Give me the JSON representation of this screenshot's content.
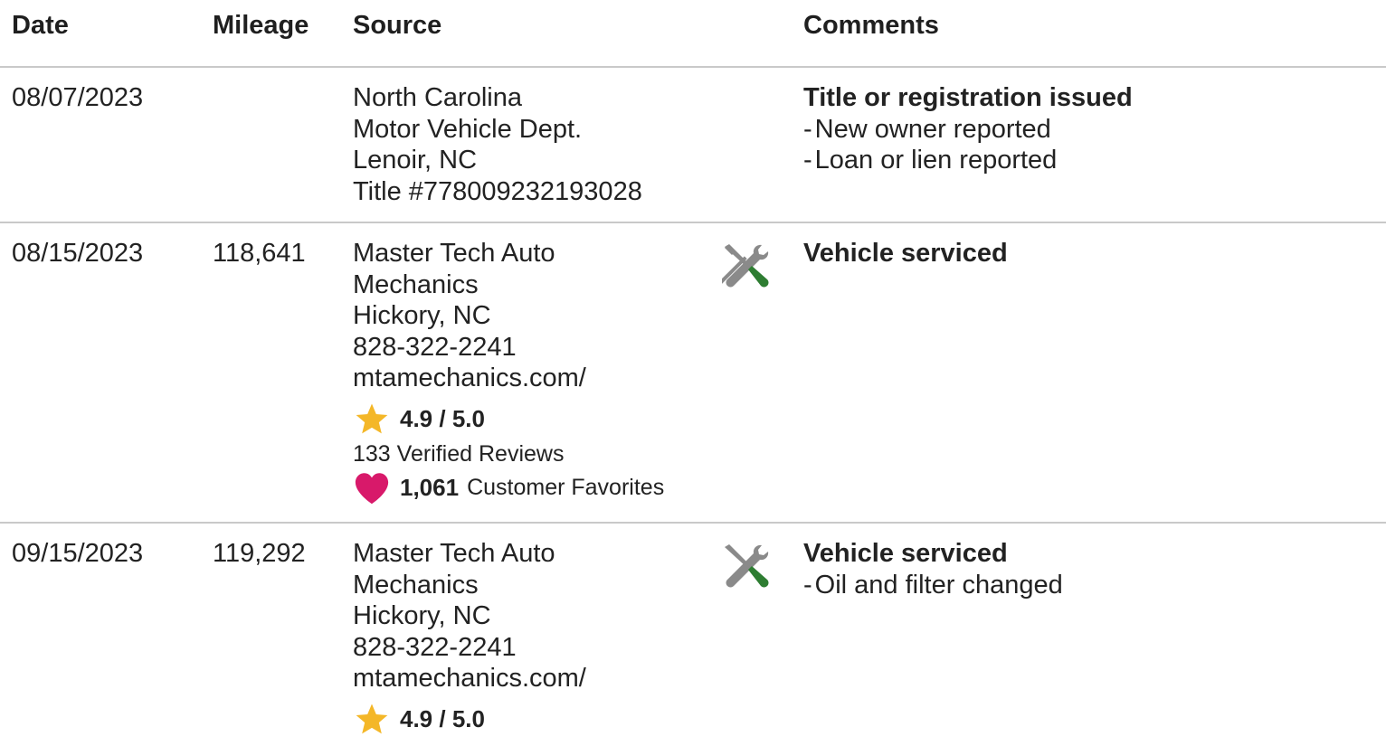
{
  "header": {
    "date": "Date",
    "mileage": "Mileage",
    "source": "Source",
    "comments": "Comments"
  },
  "rows": [
    {
      "date": "08/07/2023",
      "mileage": "",
      "source": {
        "lines": [
          "North Carolina",
          "Motor Vehicle Dept.",
          "Lenoir, NC",
          "Title #778009232193028"
        ]
      },
      "icon": "",
      "comment": {
        "title": "Title or registration issued",
        "items": [
          "New owner reported",
          "Loan or lien reported"
        ]
      }
    },
    {
      "date": "08/15/2023",
      "mileage": "118,641",
      "source": {
        "lines": [
          "Master Tech Auto",
          "Mechanics",
          "Hickory, NC",
          "828-322-2241",
          "mtamechanics.com/"
        ],
        "rating": "4.9 / 5.0",
        "reviews": "133 Verified Reviews",
        "favorites_count": "1,061",
        "favorites_label": "Customer Favorites"
      },
      "icon": "service-tools-icon",
      "comment": {
        "title": "Vehicle serviced",
        "items": []
      }
    },
    {
      "date": "09/15/2023",
      "mileage": "119,292",
      "source": {
        "lines": [
          "Master Tech Auto",
          "Mechanics",
          "Hickory, NC",
          "828-322-2241",
          "mtamechanics.com/"
        ],
        "rating": "4.9 / 5.0"
      },
      "icon": "service-tools-icon",
      "comment": {
        "title": "Vehicle serviced",
        "items": [
          "Oil and filter changed"
        ]
      }
    }
  ],
  "colors": {
    "star": "#F4B728",
    "heart": "#D8196A",
    "wrench": "#8A8A8A",
    "screwdriver_handle": "#2E7D32",
    "divider": "#C9C9C9"
  },
  "symbols": {
    "dash": "-"
  }
}
